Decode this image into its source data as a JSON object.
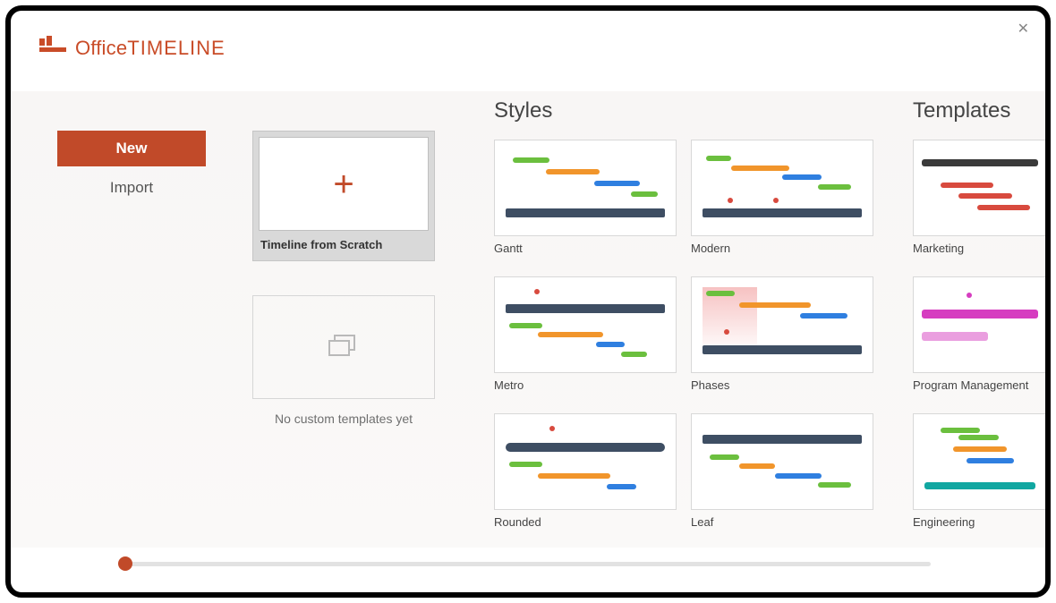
{
  "app": {
    "brand_thin": "Office",
    "brand_bold": "TIMELINE"
  },
  "sidebar": {
    "new_label": "New",
    "import_label": "Import"
  },
  "center": {
    "scratch_label": "Timeline from Scratch",
    "no_custom_label": "No custom templates yet"
  },
  "columns": {
    "styles_header": "Styles",
    "templates_header": "Templates"
  },
  "styles": [
    {
      "label": "Gantt"
    },
    {
      "label": "Modern"
    },
    {
      "label": "Metro"
    },
    {
      "label": "Phases"
    },
    {
      "label": "Rounded"
    },
    {
      "label": "Leaf"
    }
  ],
  "templates": [
    {
      "label": "Marketing"
    },
    {
      "label": "Program Management"
    },
    {
      "label": "Engineering"
    }
  ]
}
